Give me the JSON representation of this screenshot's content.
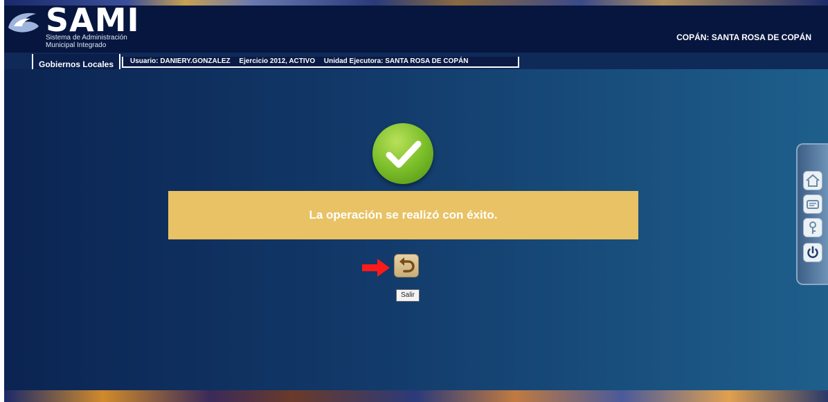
{
  "header": {
    "logo_text": "SAMI",
    "logo_subtitle_line1": "Sistema de Administración",
    "logo_subtitle_line2": "Municipal Integrado",
    "location": "COPÁN: SANTA ROSA DE COPÁN"
  },
  "tab": {
    "label": "Gobiernos Locales"
  },
  "info": {
    "usuario": "Usuario: DANIERY.GONZALEZ",
    "ejercicio": "Ejercicio 2012, ACTIVO",
    "unidad": "Unidad Ejecutora: SANTA ROSA DE COPÁN"
  },
  "message": {
    "text": "La operación se realizó con éxito."
  },
  "back_button": {
    "tooltip": "Salir"
  },
  "side_panel": {
    "icons": [
      "home-icon",
      "document-icon",
      "user-key-icon",
      "power-icon"
    ]
  },
  "colors": {
    "header_bg": "#06163f",
    "message_bg": "#e8c265",
    "success_green": "#7cbf2a",
    "arrow_red": "#ff1a1a"
  }
}
